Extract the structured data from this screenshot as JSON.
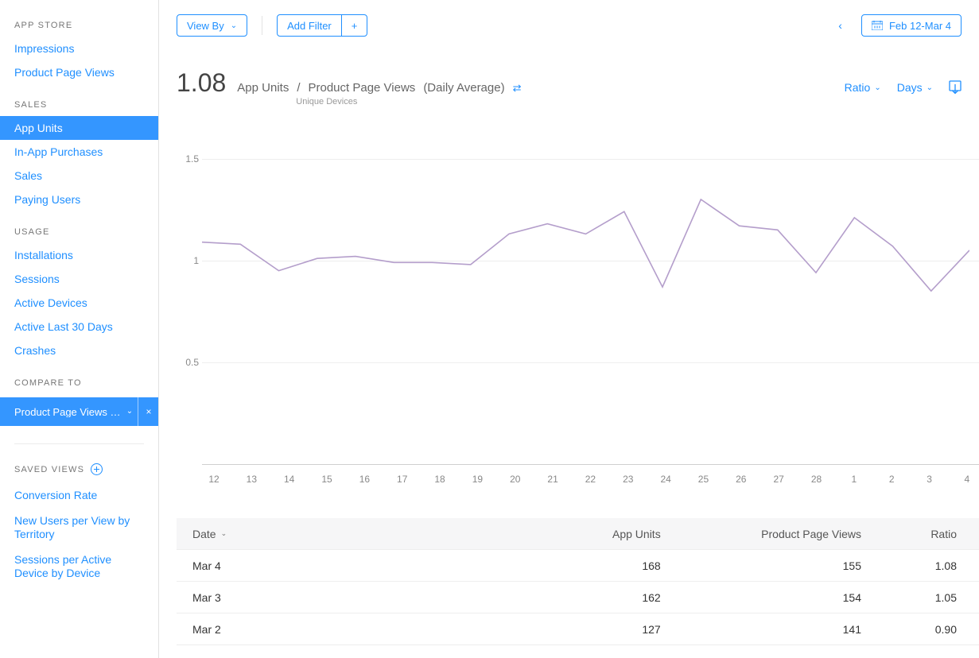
{
  "sidebar": {
    "appstore": {
      "heading": "APP STORE",
      "items": [
        "Impressions",
        "Product Page Views"
      ]
    },
    "sales": {
      "heading": "SALES",
      "items": [
        "App Units",
        "In-App Purchases",
        "Sales",
        "Paying Users"
      ],
      "active": "App Units"
    },
    "usage": {
      "heading": "USAGE",
      "items": [
        "Installations",
        "Sessions",
        "Active Devices",
        "Active Last 30 Days",
        "Crashes"
      ]
    },
    "compare": {
      "heading": "COMPARE TO",
      "value": "Product Page Views …"
    },
    "saved": {
      "heading": "SAVED VIEWS",
      "items": [
        "Conversion Rate",
        "New Users per View by Territory",
        "Sessions per Active Device by Device"
      ]
    }
  },
  "toolbar": {
    "view_by": "View By",
    "add_filter": "Add Filter",
    "date_range": "Feb 12-Mar 4"
  },
  "summary": {
    "ratio": "1.08",
    "metric_a": "App Units",
    "metric_sep": "/",
    "metric_b": "Product Page Views",
    "metric_suffix": "(Daily Average)",
    "sublabel": "Unique Devices",
    "ctrl_ratio": "Ratio",
    "ctrl_days": "Days"
  },
  "chart_data": {
    "type": "line",
    "title": "",
    "xlabel": "",
    "ylabel": "",
    "ylim": [
      0,
      1.6
    ],
    "y_ticks": [
      "0.5",
      "1",
      "1.5"
    ],
    "x_labels": [
      "12",
      "13",
      "14",
      "15",
      "16",
      "17",
      "18",
      "19",
      "20",
      "21",
      "22",
      "23",
      "24",
      "25",
      "26",
      "27",
      "28",
      "1",
      "2",
      "3",
      "4"
    ],
    "series": [
      {
        "name": "App Units / Product Page Views",
        "color": "#b49ecb",
        "values": [
          1.09,
          1.08,
          0.95,
          1.01,
          1.02,
          0.99,
          0.99,
          0.98,
          1.13,
          1.18,
          1.13,
          1.24,
          0.87,
          1.3,
          1.17,
          1.15,
          0.94,
          1.21,
          1.07,
          0.85,
          1.05
        ]
      }
    ]
  },
  "table": {
    "headers": {
      "date": "Date",
      "units": "App Units",
      "views": "Product Page Views",
      "ratio": "Ratio"
    },
    "rows": [
      {
        "date": "Mar 4",
        "units": "168",
        "views": "155",
        "ratio": "1.08"
      },
      {
        "date": "Mar 3",
        "units": "162",
        "views": "154",
        "ratio": "1.05"
      },
      {
        "date": "Mar 2",
        "units": "127",
        "views": "141",
        "ratio": "0.90"
      }
    ]
  }
}
